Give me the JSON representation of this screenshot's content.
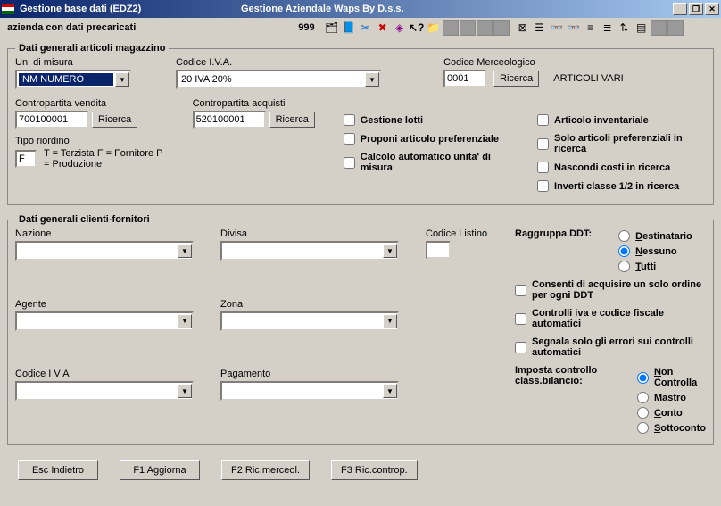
{
  "title": {
    "left": "Gestione base dati (EDZ2)",
    "center": "Gestione Aziendale Waps By D.s.s."
  },
  "status": {
    "company": "azienda con dati precaricati",
    "number": "999"
  },
  "group1": {
    "legend": "Dati generali articoli magazzino",
    "um_label": "Un. di misura",
    "um_value": "NM  NUMERO",
    "iva_label": "Codice I.V.A.",
    "iva_value": "20   IVA 20%",
    "merc_label": "Codice Merceologico",
    "merc_value": "0001",
    "merc_btn": "Ricerca",
    "merc_desc": "ARTICOLI VARI",
    "vendita_label": "Contropartita vendita",
    "vendita_value": "700100001",
    "vendita_btn": "Ricerca",
    "acquisti_label": "Contropartita acquisti",
    "acquisti_value": "520100001",
    "acquisti_btn": "Ricerca",
    "tipo_label": "Tipo riordino",
    "tipo_value": "F",
    "tipo_hint": "T = Terzista  F = Fornitore  P = Produzione",
    "chk_lotti": "Gestione lotti",
    "chk_proponi": "Proponi articolo preferenziale",
    "chk_calcolo": "Calcolo automatico unita' di misura",
    "chk_inventariale": "Articolo inventariale",
    "chk_solo": "Solo articoli preferenziali in ricerca",
    "chk_nascondi": "Nascondi costi in ricerca",
    "chk_inverti": "Inverti classe 1/2 in ricerca"
  },
  "group2": {
    "legend": "Dati generali clienti-fornitori",
    "nazione": "Nazione",
    "divisa": "Divisa",
    "codlist": "Codice Listino",
    "ragg_label": "Raggruppa DDT:",
    "r_destinatario": "Destinatario",
    "r_nessuno": "Nessuno",
    "r_tutti": "Tutti",
    "agente": "Agente",
    "zona": "Zona",
    "codiva": "Codice I V A",
    "pagamento": "Pagamento",
    "chk_consenti": "Consenti di acquisire un solo ordine per ogni DDT",
    "chk_controlli": "Controlli iva e codice fiscale automatici",
    "chk_segnala": "Segnala solo gli errori sui controlli automatici",
    "classb_label": "Imposta controllo class.bilancio:",
    "r_noncontrolla": "Non Controlla",
    "r_mastro": "Mastro",
    "r_conto": "Conto",
    "r_sottoconto": "Sottoconto"
  },
  "buttons": {
    "esc": "Esc Indietro",
    "f1": "F1 Aggiorna",
    "f2": "F2 Ric.merceol.",
    "f3": "F3 Ric.controp."
  }
}
